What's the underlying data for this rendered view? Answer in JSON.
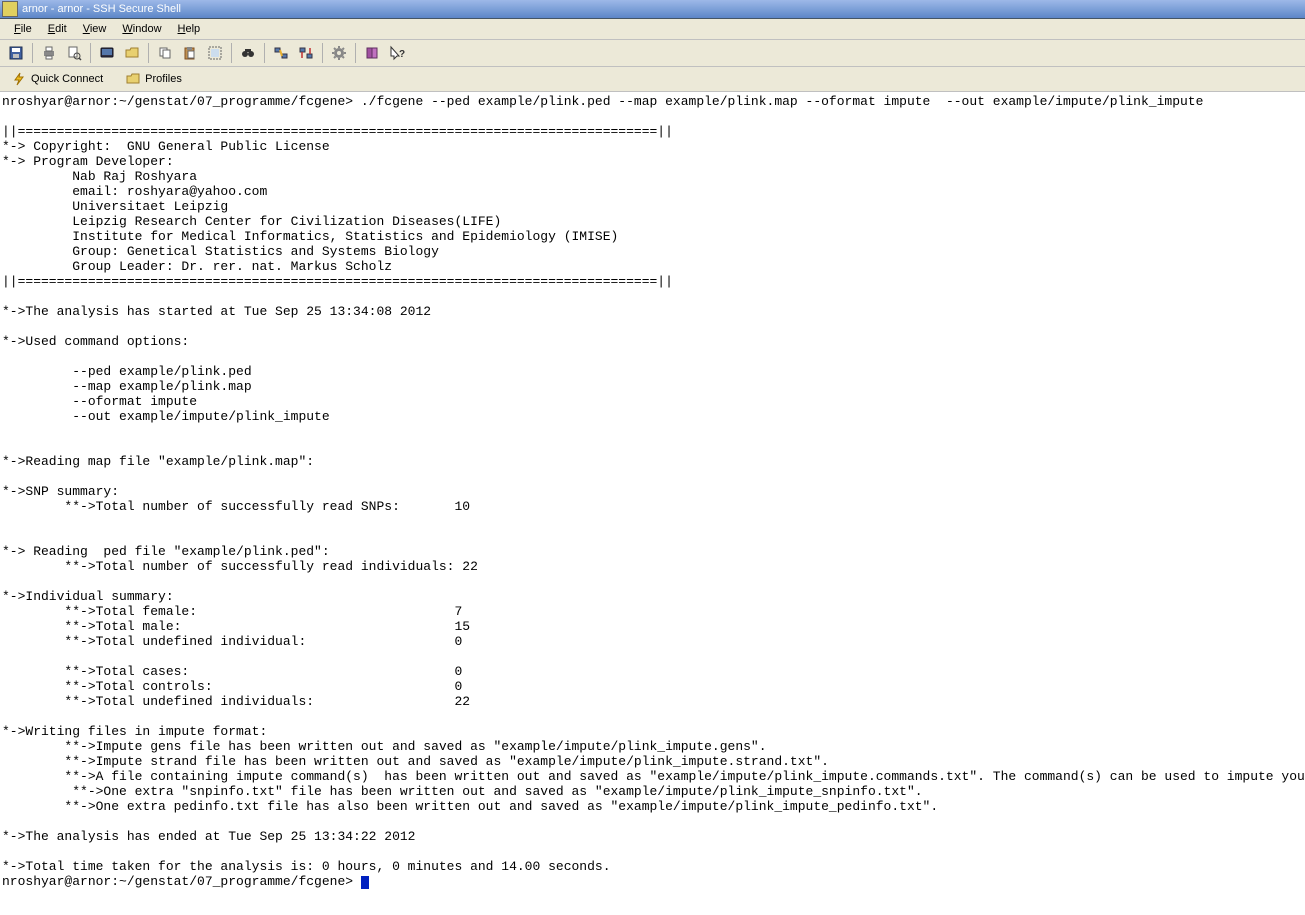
{
  "window": {
    "title": "arnor - arnor - SSH Secure Shell"
  },
  "menu": {
    "file": "File",
    "edit": "Edit",
    "view": "View",
    "window": "Window",
    "help": "Help"
  },
  "quickbar": {
    "quick_connect": "Quick Connect",
    "profiles": "Profiles"
  },
  "terminal": {
    "text": "nroshyar@arnor:~/genstat/07_programme/fcgene> ./fcgene --ped example/plink.ped --map example/plink.map --oformat impute  --out example/impute/plink_impute\n\n||==================================================================================||\n*-> Copyright:  GNU General Public License\n*-> Program Developer:\n         Nab Raj Roshyara\n         email: roshyara@yahoo.com\n         Universitaet Leipzig\n         Leipzig Research Center for Civilization Diseases(LIFE)\n         Institute for Medical Informatics, Statistics and Epidemiology (IMISE)\n         Group: Genetical Statistics and Systems Biology\n         Group Leader: Dr. rer. nat. Markus Scholz\n||==================================================================================||\n\n*->The analysis has started at Tue Sep 25 13:34:08 2012\n\n*->Used command options:\n\n         --ped example/plink.ped\n         --map example/plink.map\n         --oformat impute\n         --out example/impute/plink_impute\n\n\n*->Reading map file \"example/plink.map\":\n\n*->SNP summary:\n        **->Total number of successfully read SNPs:       10\n\n\n*-> Reading  ped file \"example/plink.ped\":\n        **->Total number of successfully read individuals: 22\n\n*->Individual summary:\n        **->Total female:                                 7\n        **->Total male:                                   15\n        **->Total undefined individual:                   0\n\n        **->Total cases:                                  0\n        **->Total controls:                               0\n        **->Total undefined individuals:                  22\n\n*->Writing files in impute format:\n        **->Impute gens file has been written out and saved as \"example/impute/plink_impute.gens\".\n        **->Impute strand file has been written out and saved as \"example/impute/plink_impute.strand.txt\".\n        **->A file containing impute command(s)  has been written out and saved as \"example/impute/plink_impute.commands.txt\". The command(s) can be used to impute your genotype data.\n         **->One extra \"snpinfo.txt\" file has been written out and saved as \"example/impute/plink_impute_snpinfo.txt\".\n        **->One extra pedinfo.txt file has also been written out and saved as \"example/impute/plink_impute_pedinfo.txt\".\n\n*->The analysis has ended at Tue Sep 25 13:34:22 2012\n\n*->Total time taken for the analysis is: 0 hours, 0 minutes and 14.00 seconds.\nnroshyar@arnor:~/genstat/07_programme/fcgene> "
  }
}
